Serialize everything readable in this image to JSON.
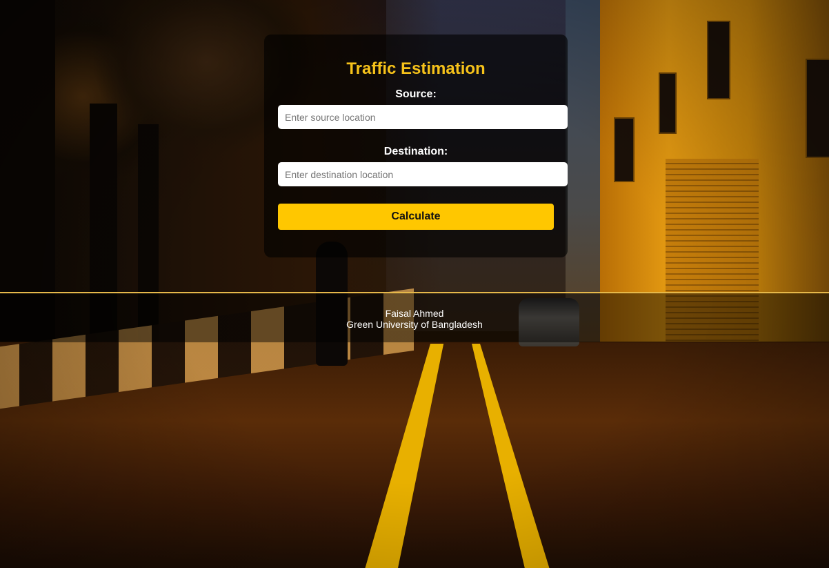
{
  "form": {
    "title": "Traffic Estimation",
    "source_label": "Source:",
    "source_placeholder": "Enter source location",
    "source_value": "",
    "destination_label": "Destination:",
    "destination_placeholder": "Enter destination location",
    "destination_value": "",
    "calculate_label": "Calculate"
  },
  "footer": {
    "author": "Faisal Ahmed",
    "institution": "Green University of Bangladesh"
  },
  "colors": {
    "accent": "#f6c21a",
    "button": "#ffc700",
    "footer_border": "#e6b84a"
  }
}
